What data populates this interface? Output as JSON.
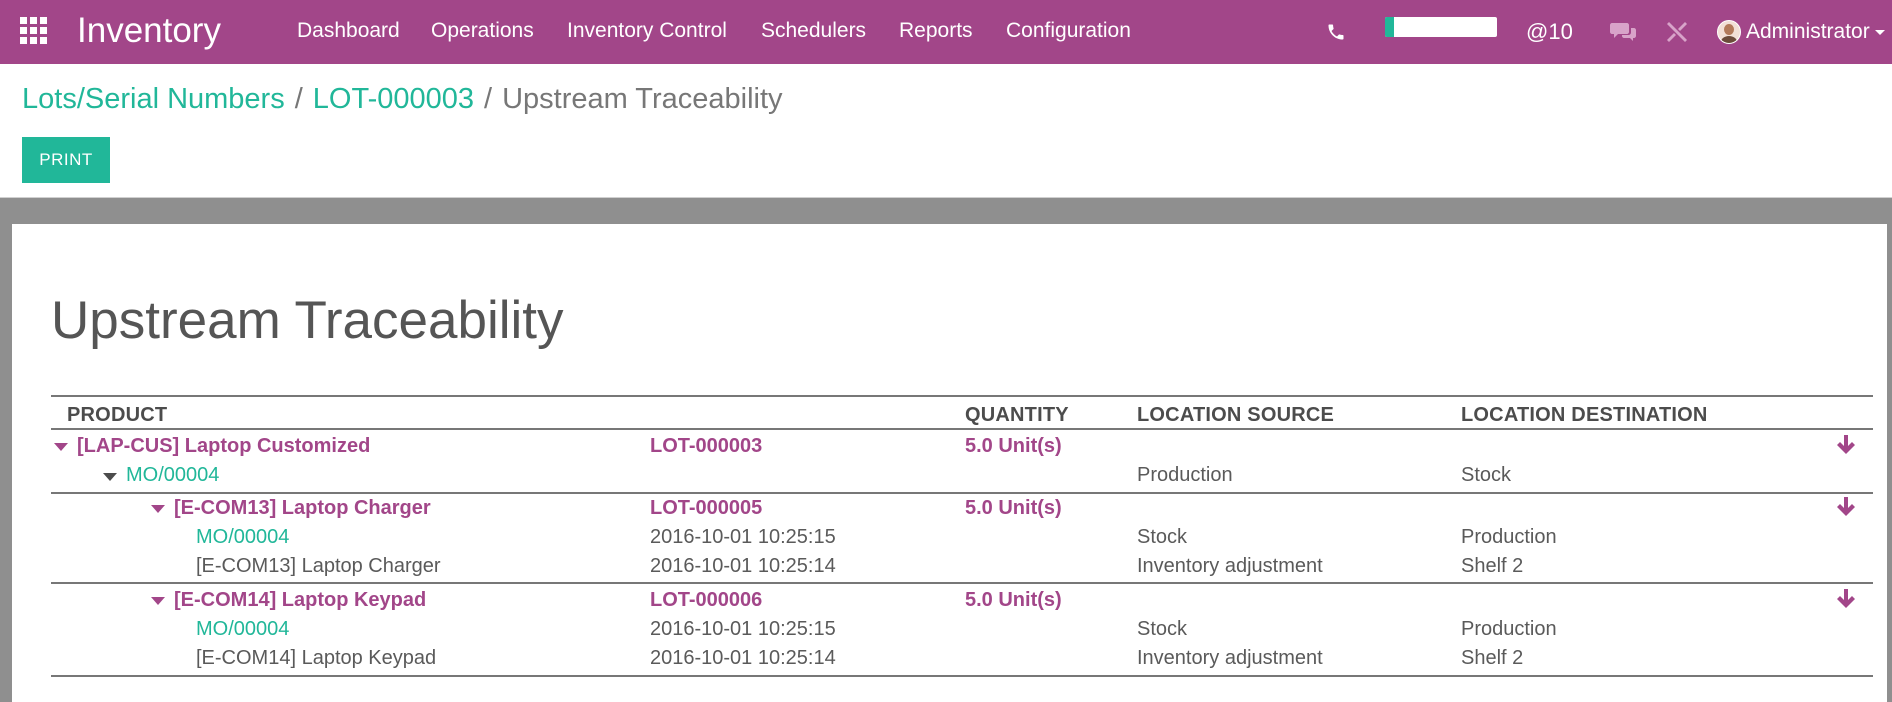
{
  "navbar": {
    "app_title": "Inventory",
    "menu": [
      "Dashboard",
      "Operations",
      "Inventory Control",
      "Schedulers",
      "Reports",
      "Configuration"
    ],
    "progress": 0.08,
    "mention_count": "@10",
    "user": "Administrator",
    "color": "#a24689"
  },
  "breadcrumb": {
    "items": [
      "Lots/Serial Numbers",
      "LOT-000003"
    ],
    "separator": "/",
    "current": "Upstream Traceability"
  },
  "buttons": {
    "print": "PRINT"
  },
  "report": {
    "title": "Upstream Traceability",
    "columns": {
      "product": "PRODUCT",
      "quantity": "QUANTITY",
      "location_source": "LOCATION SOURCE",
      "location_destination": "LOCATION DESTINATION"
    },
    "rows": {
      "r1": {
        "product": "[LAP-CUS] Laptop Customized",
        "lot": "LOT-000003",
        "quantity": "5.0 Unit(s)"
      },
      "r2": {
        "product": "MO/00004",
        "source": "Production",
        "destination": "Stock"
      },
      "r3": {
        "product": "[E-COM13] Laptop Charger",
        "lot": "LOT-000005",
        "quantity": "5.0 Unit(s)"
      },
      "r4": {
        "product": "MO/00004",
        "date": "2016-10-01 10:25:15",
        "source": "Stock",
        "destination": "Production"
      },
      "r5": {
        "product": "[E-COM13] Laptop Charger",
        "date": "2016-10-01 10:25:14",
        "source": "Inventory adjustment",
        "destination": "Shelf 2"
      },
      "r6": {
        "product": "[E-COM14] Laptop Keypad",
        "lot": "LOT-000006",
        "quantity": "5.0 Unit(s)"
      },
      "r7": {
        "product": "MO/00004",
        "date": "2016-10-01 10:25:15",
        "source": "Stock",
        "destination": "Production"
      },
      "r8": {
        "product": "[E-COM14] Laptop Keypad",
        "date": "2016-10-01 10:25:14",
        "source": "Inventory adjustment",
        "destination": "Shelf 2"
      }
    }
  },
  "colors": {
    "accent": "#21b799",
    "brand": "#a24689"
  }
}
